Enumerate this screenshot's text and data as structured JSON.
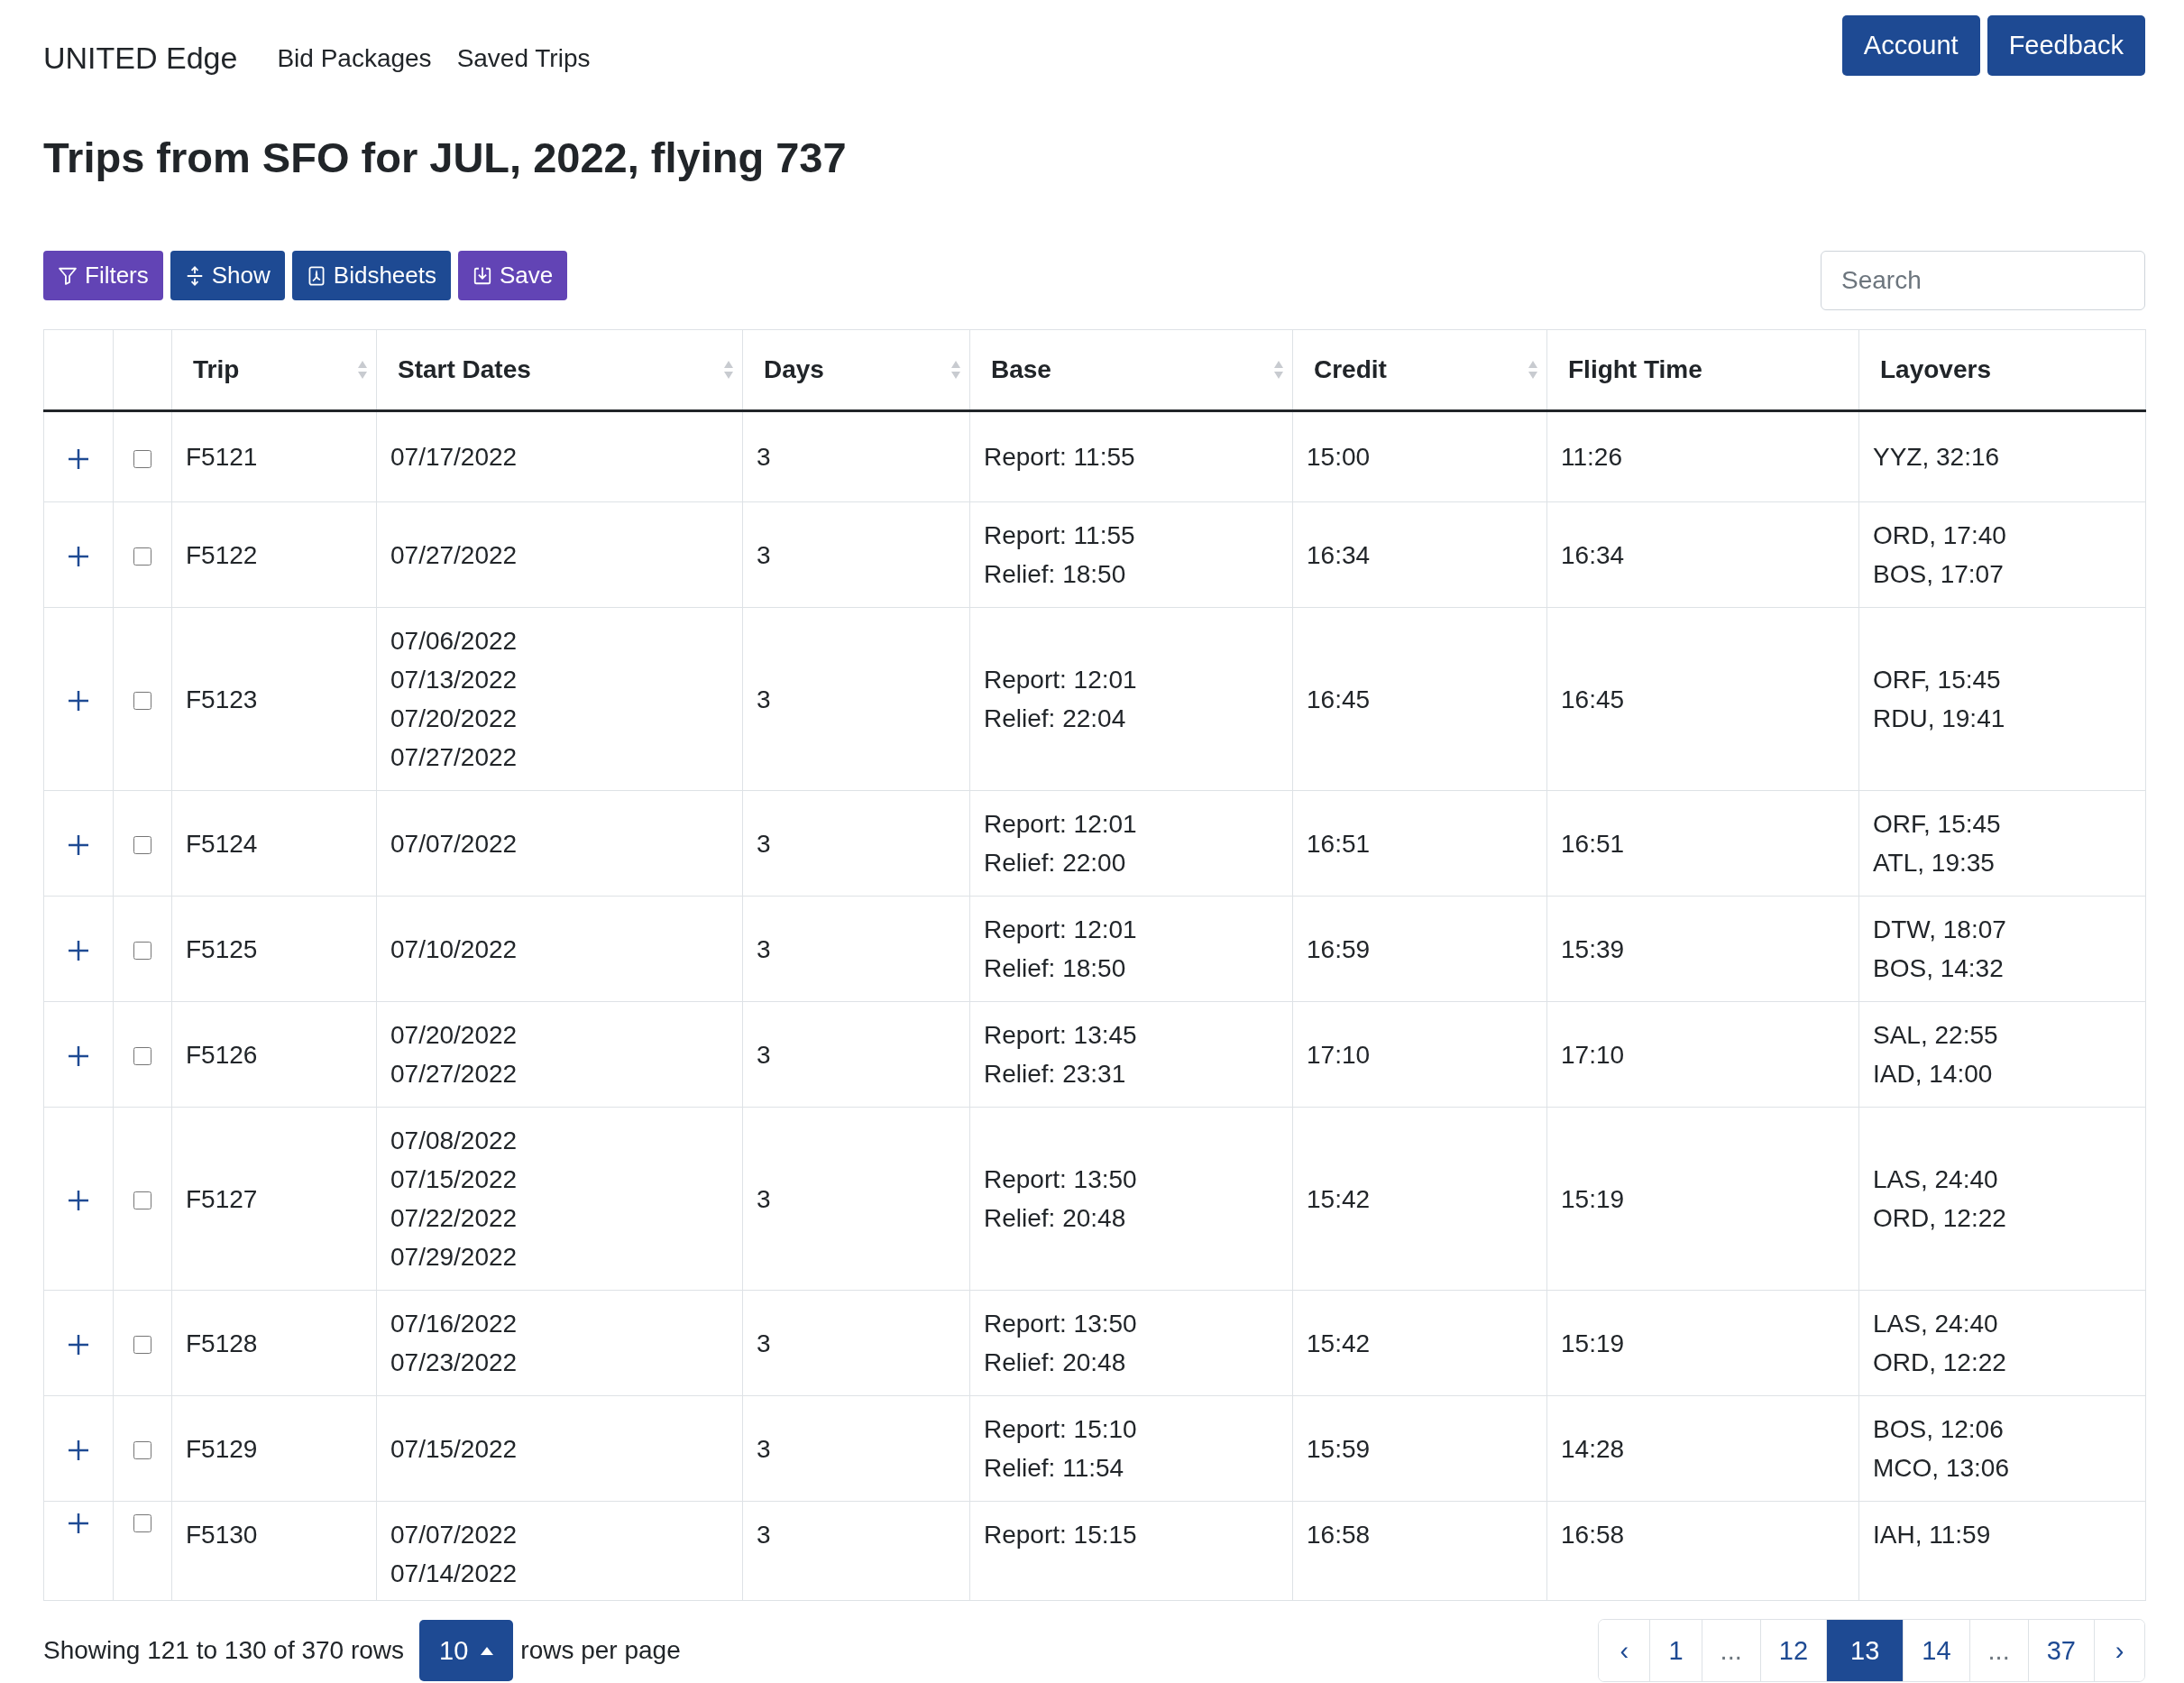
{
  "navbar": {
    "brand": "UNITED Edge",
    "links": [
      "Bid Packages",
      "Saved Trips"
    ],
    "buttons": [
      "Account",
      "Feedback"
    ]
  },
  "title": "Trips from SFO for JUL, 2022, flying 737",
  "toolbar": [
    {
      "label": "Filters",
      "kind": "filter",
      "color": "#6244b5"
    },
    {
      "label": "Show",
      "kind": "show",
      "color": "#1e4a93"
    },
    {
      "label": "Bidsheets",
      "kind": "bidsheets",
      "color": "#1e4a93"
    },
    {
      "label": "Save",
      "kind": "save",
      "color": "#6244b5"
    }
  ],
  "search": {
    "placeholder": "Search"
  },
  "table": {
    "columns": [
      {
        "label": "Trip",
        "sortable": true
      },
      {
        "label": "Start Dates",
        "sortable": true
      },
      {
        "label": "Days",
        "sortable": true
      },
      {
        "label": "Base",
        "sortable": true
      },
      {
        "label": "Credit",
        "sortable": true
      },
      {
        "label": "Flight Time",
        "sortable": false
      },
      {
        "label": "Layovers",
        "sortable": false
      }
    ],
    "rows": [
      {
        "checked": false,
        "trip": "F5121",
        "start_dates": [
          "07/17/2022"
        ],
        "days": "3",
        "base": [
          "Report: 11:55"
        ],
        "credit": "15:00",
        "flight_time": "11:26",
        "layovers": [
          "YYZ, 32:16"
        ]
      },
      {
        "checked": false,
        "trip": "F5122",
        "start_dates": [
          "07/27/2022"
        ],
        "days": "3",
        "base": [
          "Report: 11:55",
          "Relief: 18:50"
        ],
        "credit": "16:34",
        "flight_time": "16:34",
        "layovers": [
          "ORD, 17:40",
          "BOS, 17:07"
        ]
      },
      {
        "checked": false,
        "trip": "F5123",
        "start_dates": [
          "07/06/2022",
          "07/13/2022",
          "07/20/2022",
          "07/27/2022"
        ],
        "days": "3",
        "base": [
          "Report: 12:01",
          "Relief: 22:04"
        ],
        "credit": "16:45",
        "flight_time": "16:45",
        "layovers": [
          "ORF, 15:45",
          "RDU, 19:41"
        ]
      },
      {
        "checked": false,
        "trip": "F5124",
        "start_dates": [
          "07/07/2022"
        ],
        "days": "3",
        "base": [
          "Report: 12:01",
          "Relief: 22:00"
        ],
        "credit": "16:51",
        "flight_time": "16:51",
        "layovers": [
          "ORF, 15:45",
          "ATL, 19:35"
        ]
      },
      {
        "checked": false,
        "trip": "F5125",
        "start_dates": [
          "07/10/2022"
        ],
        "days": "3",
        "base": [
          "Report: 12:01",
          "Relief: 18:50"
        ],
        "credit": "16:59",
        "flight_time": "15:39",
        "layovers": [
          "DTW, 18:07",
          "BOS, 14:32"
        ]
      },
      {
        "checked": false,
        "trip": "F5126",
        "start_dates": [
          "07/20/2022",
          "07/27/2022"
        ],
        "days": "3",
        "base": [
          "Report: 13:45",
          "Relief: 23:31"
        ],
        "credit": "17:10",
        "flight_time": "17:10",
        "layovers": [
          "SAL, 22:55",
          "IAD, 14:00"
        ]
      },
      {
        "checked": false,
        "trip": "F5127",
        "start_dates": [
          "07/08/2022",
          "07/15/2022",
          "07/22/2022",
          "07/29/2022"
        ],
        "days": "3",
        "base": [
          "Report: 13:50",
          "Relief: 20:48"
        ],
        "credit": "15:42",
        "flight_time": "15:19",
        "layovers": [
          "LAS, 24:40",
          "ORD, 12:22"
        ]
      },
      {
        "checked": false,
        "trip": "F5128",
        "start_dates": [
          "07/16/2022",
          "07/23/2022"
        ],
        "days": "3",
        "base": [
          "Report: 13:50",
          "Relief: 20:48"
        ],
        "credit": "15:42",
        "flight_time": "15:19",
        "layovers": [
          "LAS, 24:40",
          "ORD, 12:22"
        ]
      },
      {
        "checked": false,
        "trip": "F5129",
        "start_dates": [
          "07/15/2022"
        ],
        "days": "3",
        "base": [
          "Report: 15:10",
          "Relief: 11:54"
        ],
        "credit": "15:59",
        "flight_time": "14:28",
        "layovers": [
          "BOS, 12:06",
          "MCO, 13:06"
        ]
      },
      {
        "checked": false,
        "trip": "F5130",
        "start_dates": [
          "07/07/2022",
          "07/14/2022"
        ],
        "days": "3",
        "base": [
          "Report: 15:15"
        ],
        "credit": "16:58",
        "flight_time": "16:58",
        "layovers": [
          "IAH, 11:59"
        ]
      }
    ]
  },
  "footer": {
    "showing": "Showing 121 to 130 of 370 rows",
    "page_size": "10",
    "per_page": "rows per page",
    "pages": [
      {
        "label": "‹",
        "kind": "prev",
        "selected": false
      },
      {
        "label": "1",
        "kind": "page",
        "selected": false
      },
      {
        "label": "...",
        "kind": "gap",
        "selected": false
      },
      {
        "label": "12",
        "kind": "page",
        "selected": false
      },
      {
        "label": "13",
        "kind": "page",
        "selected": true
      },
      {
        "label": "14",
        "kind": "page",
        "selected": false
      },
      {
        "label": "...",
        "kind": "gap",
        "selected": false
      },
      {
        "label": "37",
        "kind": "page",
        "selected": false
      },
      {
        "label": "›",
        "kind": "next",
        "selected": false
      }
    ]
  }
}
